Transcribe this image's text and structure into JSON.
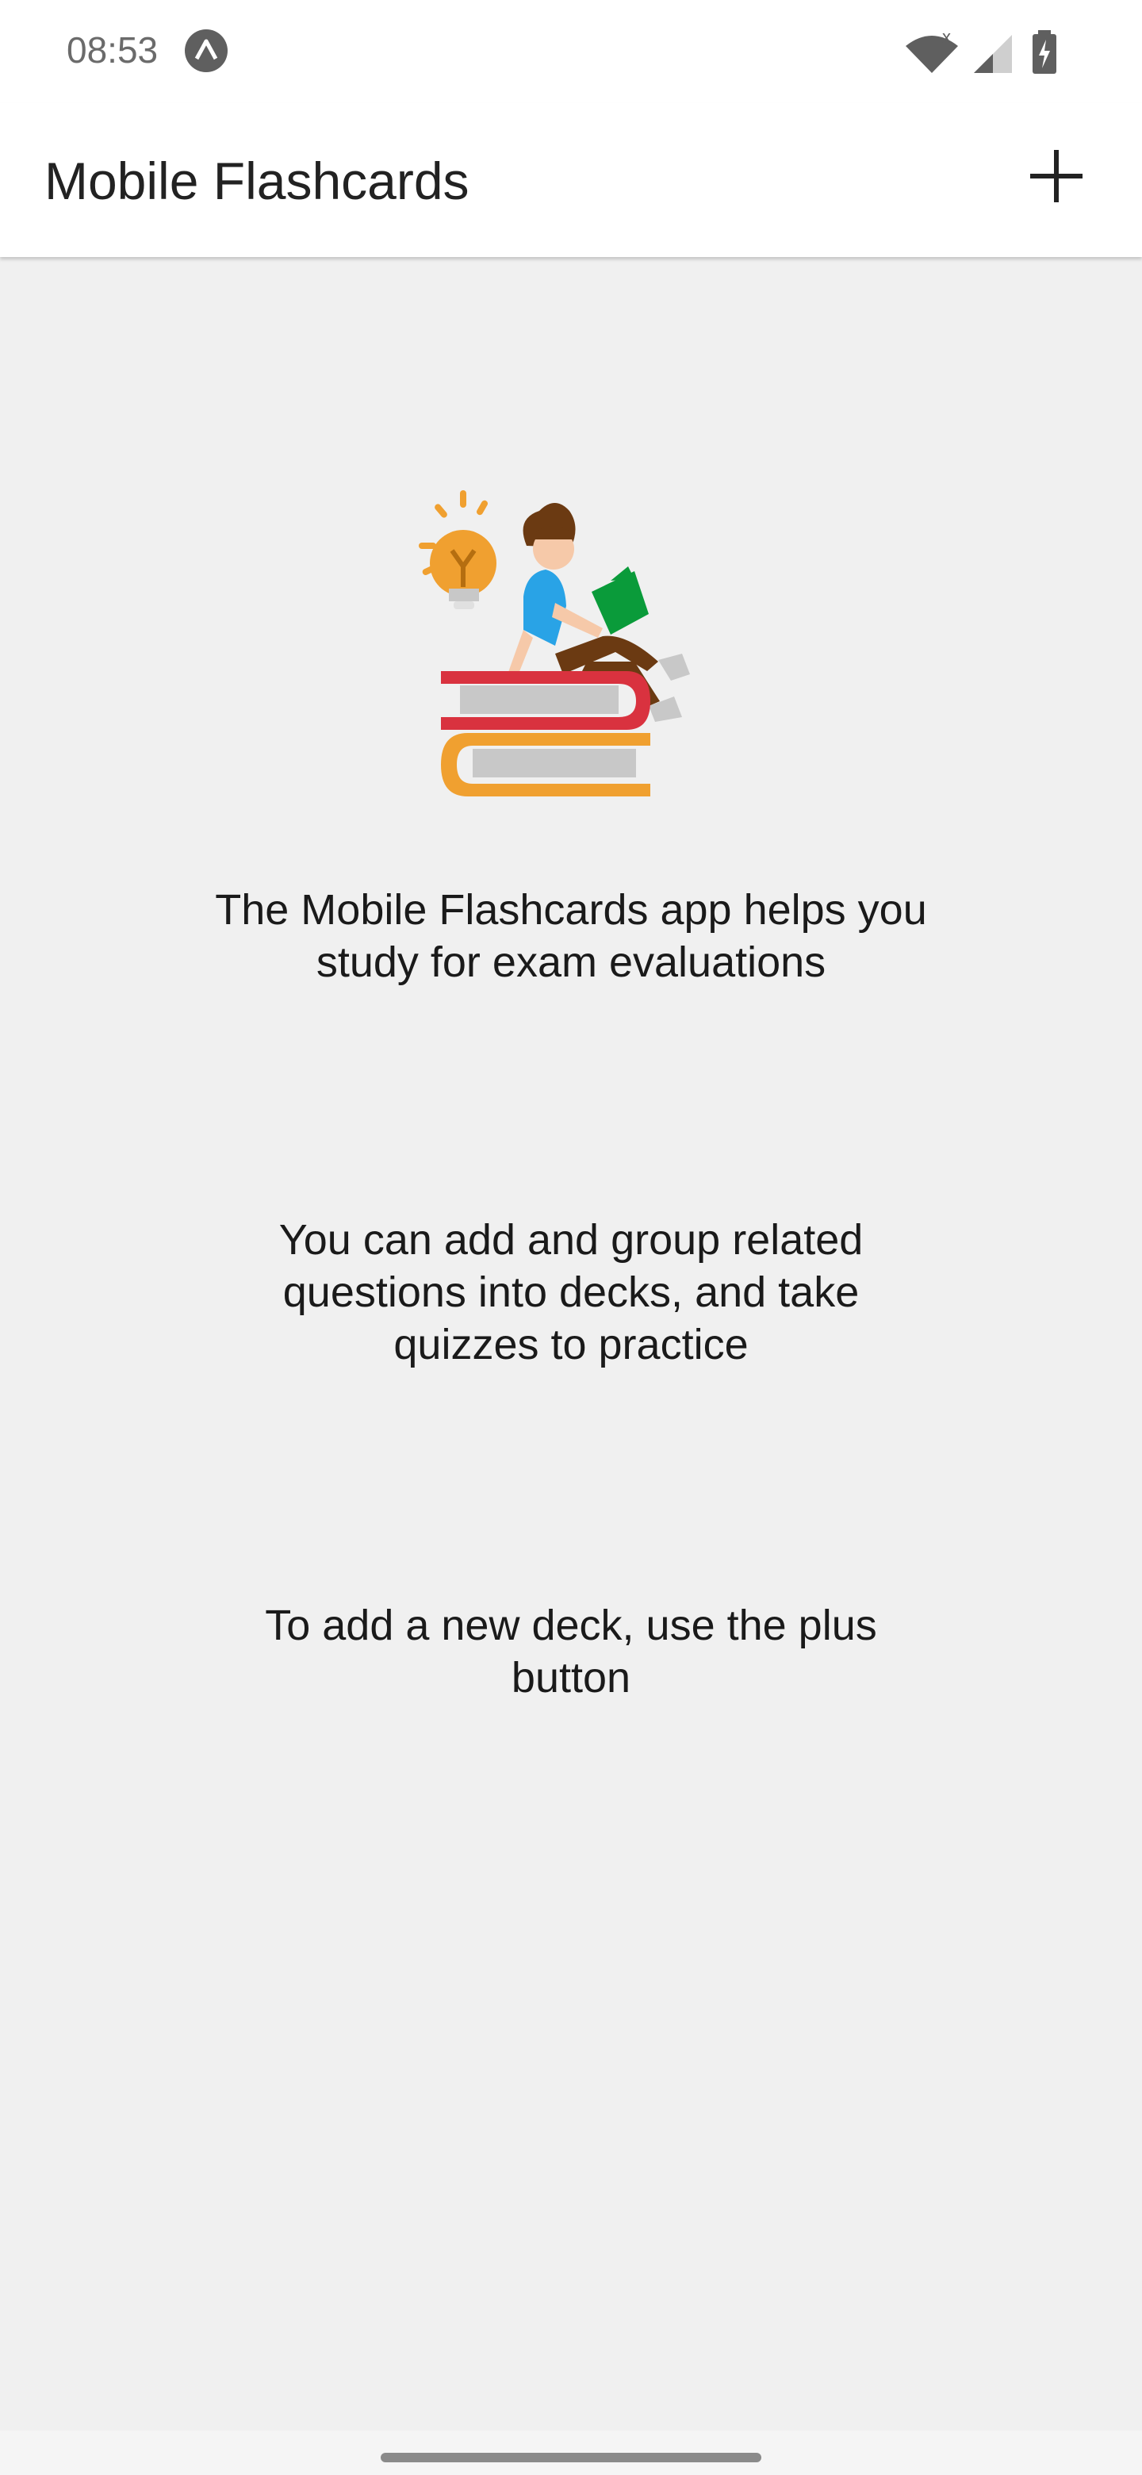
{
  "status_bar": {
    "time": "08:53",
    "icons": [
      "expo-icon",
      "wifi-icon",
      "signal-icon",
      "battery-charging-icon"
    ]
  },
  "app_bar": {
    "title": "Mobile Flashcards",
    "add_icon": "plus-icon"
  },
  "main": {
    "illustration": "student-reading-on-books-illustration",
    "paragraphs": [
      "The Mobile Flashcards app helps you study for exam evaluations",
      "You can add and group related questions into decks, and take quizzes to practice",
      "To add a new deck, use the plus button"
    ]
  },
  "colors": {
    "background": "#f0f0f0",
    "app_bar": "#ffffff",
    "text": "#1a1a1a"
  }
}
